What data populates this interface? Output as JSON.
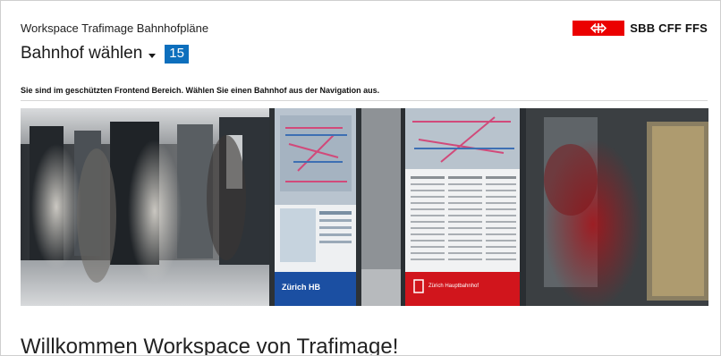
{
  "header": {
    "app_title": "Workspace Trafimage Bahnhofpläne",
    "brand_name": "SBB CFF FFS",
    "brand_color": "#eb0000"
  },
  "station_picker": {
    "label": "Bahnhof wählen",
    "count": "15",
    "badge_color": "#0d6fbd"
  },
  "notice": "Sie sind im geschützten Frontend Bereich. Wählen Sie einen Bahnhof aus der Navigation aus.",
  "hero": {
    "left_sign_label": "Zürich HB",
    "right_sign_label": "Zürich Hauptbahnhof"
  },
  "welcome_heading": "Willkommen Workspace von Trafimage!"
}
